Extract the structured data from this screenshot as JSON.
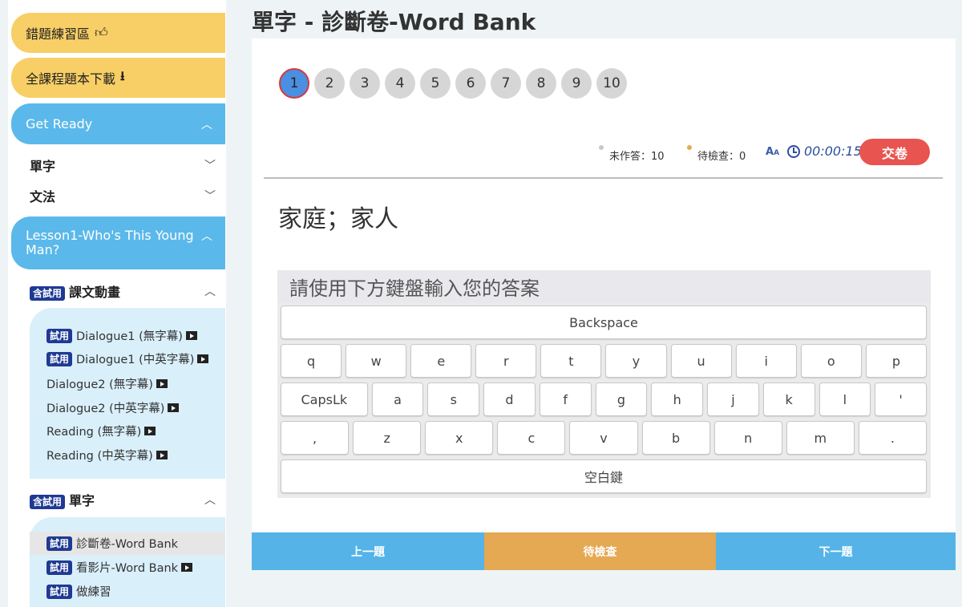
{
  "sidebar": {
    "wrong_practice": "錯題練習區",
    "download_all": "全課程題本下載",
    "get_ready": "Get Ready",
    "vocab": "單字",
    "grammar": "文法",
    "lesson1": "Lesson1-Who's This Young Man?",
    "trial_badge": "含試用",
    "trial_small": "試用",
    "text_animation": "課文動畫",
    "lesson_items": [
      {
        "label": "Dialogue1 (無字幕)"
      },
      {
        "label": "Dialogue1 (中英字幕)"
      },
      {
        "label": "Dialogue2 (無字幕)"
      },
      {
        "label": "Dialogue2 (中英字幕)"
      },
      {
        "label": "Reading (無字幕)"
      },
      {
        "label": "Reading (中英字幕)"
      }
    ],
    "vocab_section": "單字",
    "vocab_items": [
      {
        "label": "診斷卷-Word Bank"
      },
      {
        "label": "看影片-Word Bank"
      },
      {
        "label": "做練習"
      }
    ]
  },
  "main": {
    "title": "單字 - 診斷卷-Word Bank",
    "question_numbers": [
      "1",
      "2",
      "3",
      "4",
      "5",
      "6",
      "7",
      "8",
      "9",
      "10"
    ],
    "status_unanswered": "未作答：10",
    "status_review": "待檢查：0",
    "font_size_label": "A",
    "font_size_small": "A",
    "timer": "00:00:15",
    "submit": "交卷",
    "question": "家庭；家人",
    "answer_placeholder": "請使用下方鍵盤輸入您的答案"
  },
  "keyboard": {
    "backspace": "Backspace",
    "row1": [
      "q",
      "w",
      "e",
      "r",
      "t",
      "y",
      "u",
      "i",
      "o",
      "p"
    ],
    "row2": [
      "CapsLk",
      "a",
      "s",
      "d",
      "f",
      "g",
      "h",
      "j",
      "k",
      "l",
      "'"
    ],
    "row3": [
      ",",
      "z",
      "x",
      "c",
      "v",
      "b",
      "n",
      "m",
      "."
    ],
    "space": "空白鍵"
  },
  "bottom": {
    "prev": "上一題",
    "check": "待檢查",
    "next": "下一題"
  },
  "colors": {
    "yellow": "#f8cf66",
    "blue": "#5bb8ea",
    "orange": "#e5a853",
    "red": "#e8544f",
    "navy": "#1f3a93"
  }
}
